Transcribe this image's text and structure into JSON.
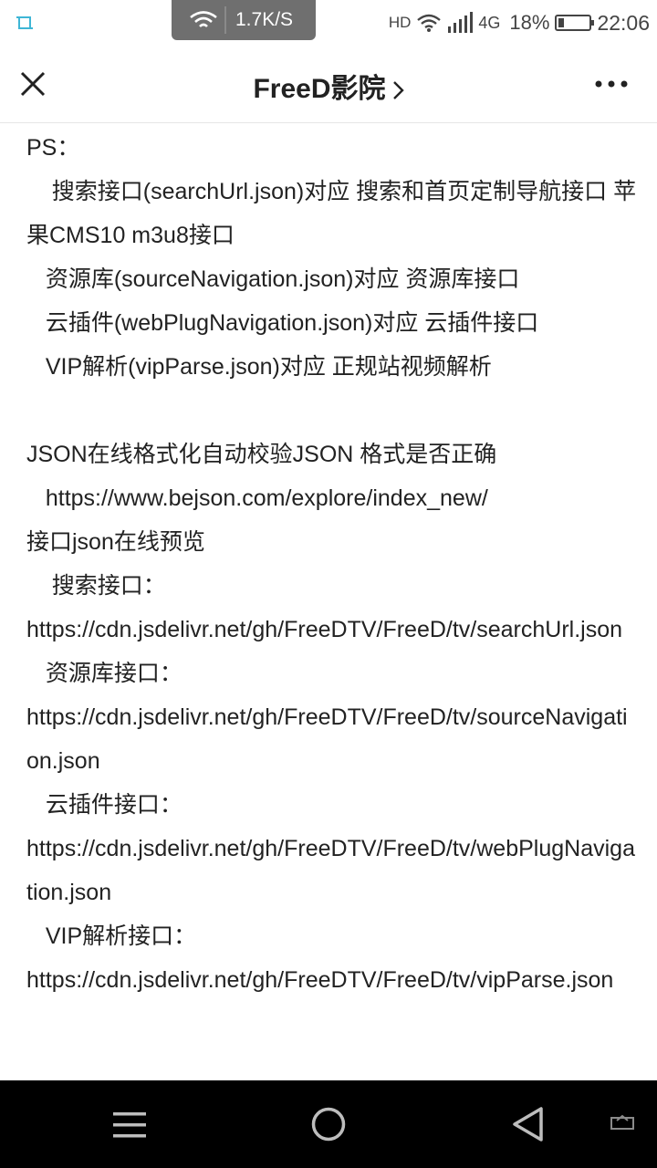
{
  "status_bar": {
    "net_speed": "1.7K/S",
    "hd": "HD",
    "network": "4G",
    "battery_percent": "18%",
    "battery_level": 0.18,
    "time": "22:06"
  },
  "header": {
    "title": "FreeD影院"
  },
  "content": {
    "lines": [
      "PS：",
      "    搜索接口(searchUrl.json)对应 搜索和首页定制导航接口 苹果CMS10 m3u8接口",
      "   资源库(sourceNavigation.json)对应 资源库接口",
      "   云插件(webPlugNavigation.json)对应 云插件接口",
      "   VIP解析(vipParse.json)对应 正规站视频解析",
      "",
      "JSON在线格式化自动校验JSON 格式是否正确",
      "   https://www.bejson.com/explore/index_new/",
      "接口json在线预览",
      "    搜索接口：",
      "https://cdn.jsdelivr.net/gh/FreeDTV/FreeD/tv/searchUrl.json",
      "   资源库接口：",
      "https://cdn.jsdelivr.net/gh/FreeDTV/FreeD/tv/sourceNavigation.json",
      "   云插件接口：",
      "https://cdn.jsdelivr.net/gh/FreeDTV/FreeD/tv/webPlugNavigation.json",
      "   VIP解析接口：",
      "https://cdn.jsdelivr.net/gh/FreeDTV/FreeD/tv/vipParse.json"
    ]
  }
}
